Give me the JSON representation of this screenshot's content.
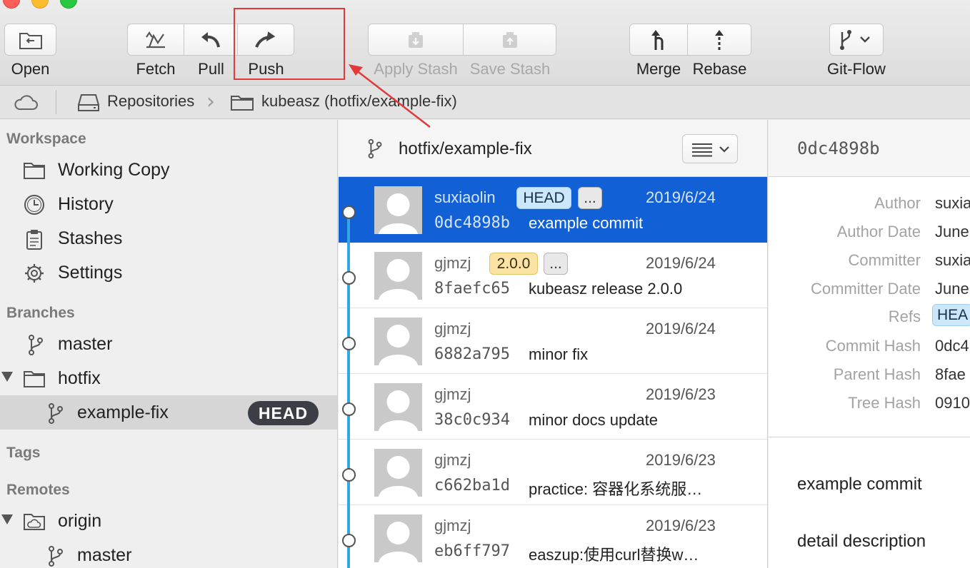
{
  "toolbar": {
    "open_label": "Open",
    "fetch_label": "Fetch",
    "pull_label": "Pull",
    "push_label": "Push",
    "apply_stash_label": "Apply Stash",
    "save_stash_label": "Save Stash",
    "merge_label": "Merge",
    "rebase_label": "Rebase",
    "gitflow_label": "Git-Flow",
    "icons": [
      "folder-open-icon",
      "fetch-icon",
      "pull-icon",
      "push-icon",
      "apply-stash-icon",
      "save-stash-icon",
      "merge-icon",
      "rebase-icon",
      "git-flow-icon"
    ],
    "annotation_color": "#e03a3a"
  },
  "pathbar": {
    "repositories_label": "Repositories",
    "repo_label": "kubeasz (hotfix/example-fix)"
  },
  "sidebar": {
    "workspace_header": "Workspace",
    "workspace_items": [
      {
        "label": "Working Copy",
        "icon": "folder-icon"
      },
      {
        "label": "History",
        "icon": "clock-icon"
      },
      {
        "label": "Stashes",
        "icon": "clipboard-icon"
      },
      {
        "label": "Settings",
        "icon": "gear-icon"
      }
    ],
    "branches_header": "Branches",
    "branches": [
      {
        "label": "master",
        "icon": "branch-icon"
      },
      {
        "label": "hotfix",
        "icon": "folder-icon"
      },
      {
        "label": "example-fix",
        "icon": "branch-icon",
        "badge": "HEAD"
      }
    ],
    "tags_header": "Tags",
    "remotes_header": "Remotes",
    "remotes": [
      {
        "label": "origin",
        "icon": "cloud-folder-icon"
      },
      {
        "label": "master",
        "icon": "branch-icon"
      }
    ]
  },
  "commits": {
    "branch_title": "hotfix/example-fix",
    "accent_color": "#1260d6",
    "graph_color": "#34a6e6",
    "rows": [
      {
        "author": "suxiaolin",
        "tag_head": "HEAD",
        "tag_more": "...",
        "date": "2019/6/24",
        "hash": "0dc4898b",
        "message": "example commit"
      },
      {
        "author": "gjmzj",
        "tag_version": "2.0.0",
        "tag_more": "...",
        "date": "2019/6/24",
        "hash": "8faefc65",
        "message": "kubeasz release 2.0.0"
      },
      {
        "author": "gjmzj",
        "date": "2019/6/24",
        "hash": "6882a795",
        "message": "minor fix"
      },
      {
        "author": "gjmzj",
        "date": "2019/6/23",
        "hash": "38c0c934",
        "message": "minor docs update"
      },
      {
        "author": "gjmzj",
        "date": "2019/6/23",
        "hash": "c662ba1d",
        "message": "practice: 容器化系统服…"
      },
      {
        "author": "gjmzj",
        "date": "2019/6/23",
        "hash": "eb6ff797",
        "message": "easzup:使用curl替换w…"
      }
    ]
  },
  "details": {
    "hash": "0dc4898b",
    "fields": [
      {
        "label": "Author",
        "value": "suxia"
      },
      {
        "label": "Author Date",
        "value": "June"
      },
      {
        "label": "Committer",
        "value": "suxia"
      },
      {
        "label": "Committer Date",
        "value": "June"
      },
      {
        "label": "Refs",
        "value": "HEA"
      },
      {
        "label": "Commit Hash",
        "value": "0dc4"
      },
      {
        "label": "Parent Hash",
        "value": "8fae"
      },
      {
        "label": "Tree Hash",
        "value": "0910"
      }
    ],
    "summary": "example commit",
    "description": "detail description"
  }
}
